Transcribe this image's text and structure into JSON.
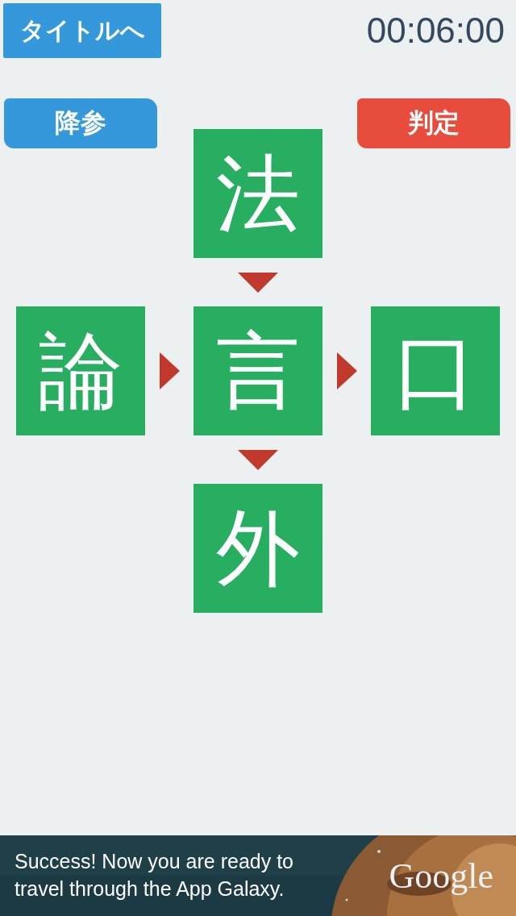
{
  "header": {
    "back_button": "タイトルへ",
    "timer": "00:06:00"
  },
  "actions": {
    "surrender_button": "降参",
    "judge_button": "判定"
  },
  "tiles": {
    "top": "法",
    "left": "論",
    "center": "言",
    "right": "口",
    "bottom": "外"
  },
  "ad_banner": {
    "message": "Success! Now you are ready to travel through the App Galaxy.",
    "brand": "Google"
  }
}
